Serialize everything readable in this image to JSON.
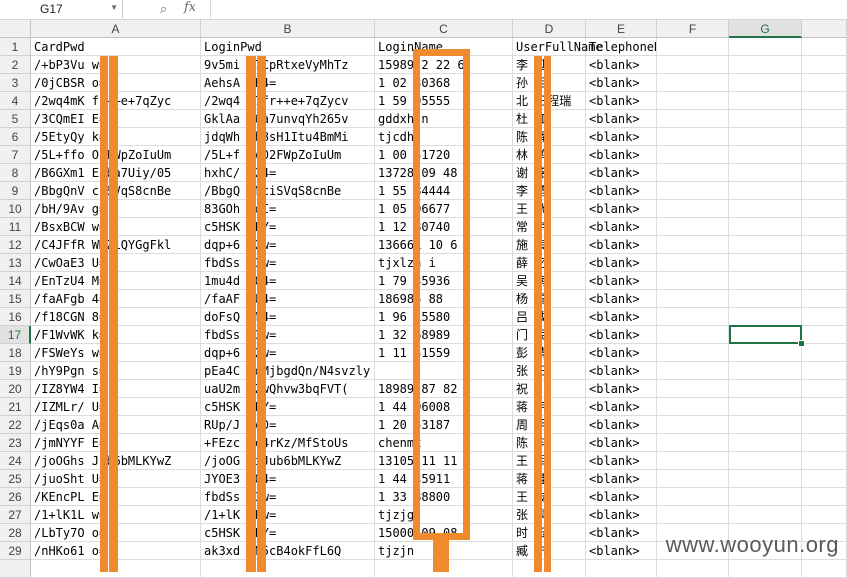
{
  "name_box": {
    "value": "G17"
  },
  "formula_bar": {
    "zoom_icon": "zoom-icon",
    "fx_label": "fx",
    "value": ""
  },
  "columns": [
    "A",
    "B",
    "C",
    "D",
    "E",
    "F",
    "G"
  ],
  "selected_cell": "G17",
  "header_row": [
    "CardPwd",
    "LoginPwd",
    "LoginName",
    "UserFullName",
    "TelephoneNumber",
    "",
    ""
  ],
  "rows": [
    [
      "/+bP3Vu  w=",
      "9v5mi  N7CpRtxeVyMhTz",
      "15989  2  22  6",
      "李  延",
      "<blank>"
    ],
    [
      "/0jCBSR  o=",
      "AehsA  zE4=",
      "1  02  30368",
      "孙  相",
      "<blank>"
    ],
    [
      "/2wq4mK  fr++e+7qZyc",
      "/2wq4  L7fr++e+7qZycv",
      "1  59  95555",
      "北  王程瑞",
      "<blank>"
    ],
    [
      "/3CQmEI  E=",
      "GklAa  S6a7unvqYh265v",
      "gddxh  n",
      "杜  江",
      "<blank>"
    ],
    [
      "/5EtyQy  k=",
      "jdqWh  gh8sH1Itu4BmMi",
      "tjcdh",
      "陈  辉",
      "<blank>"
    ],
    [
      "/5L+ffo  O2FWpZoIuUm",
      "/5L+f  6A02FWpZoIuUm",
      "1  00  51720",
      "林  鹏",
      "<blank>"
    ],
    [
      "/B6GXm1  E2ba7Uiy/05",
      "hxhC/  u24=",
      "13728  09  48",
      "谢  铭",
      "<blank>"
    ],
    [
      "/BbgQnV  ciSVqS8cnBe",
      "/BbgQ  tMciSVqS8cnBe",
      "1  55  84444",
      "李  勇",
      "<blank>"
    ],
    [
      "/bH/9Av  g=",
      "83GOh  FeI=",
      "1  05  06677",
      "王  飞",
      "<blank>"
    ],
    [
      "/BsxBCW  w=",
      "c5HSK  ILY=",
      "1  12  80740",
      "常  京",
      "<blank>"
    ],
    [
      "/C4JFfR  WMZ1QYGgFkl",
      "dqp+6  G2w=",
      "136661  10  6",
      "施  良",
      "<blank>"
    ],
    [
      "/CwOaE3  U=",
      "fbdSs  h3w=",
      "tjxlzh  i",
      "薛  忆",
      "<blank>"
    ],
    [
      "/EnTzU4  M=",
      "1mu4d  W04=",
      "1  79  35936",
      "吴  南",
      "<blank>"
    ],
    [
      "/faAFgb  4=",
      "/faAF  HU4=",
      "186985  88",
      "杨  国",
      "<blank>"
    ],
    [
      "/f18CGN  8=",
      "doFsQ  fM4=",
      "1  96  15580",
      "吕  成",
      "<blank>"
    ],
    [
      "/F1WvWK  k=",
      "fbdSs  h3w=",
      "1  32  68989",
      "门  民",
      "<blank>"
    ],
    [
      "/FSWeYs  w=",
      "dqp+6  G2w=",
      "1  11  51559",
      "彭  清",
      "<blank>"
    ],
    [
      "/hY9Pgn  s=",
      "pEa4C  beMjbgdQn/N4svzly",
      "",
      "张  日",
      "<blank>"
    ],
    [
      "/IZ8YW4  I=",
      "uaU2m  6ZwQhvw3bqFVT(",
      "18989  87  82",
      "祝  川",
      "<blank>"
    ],
    [
      "/IZMLr/  U=",
      "c5HSK  ILY=",
      "1  44  96008",
      "蒋  宇",
      "<blank>"
    ],
    [
      "/jEqs0a  A=",
      "RUp/J  oA0=",
      "1  20  53187",
      "周  明",
      "<blank>"
    ],
    [
      "/jmNYYF  E=",
      "+FEzc  dc4rKz/MfStoUs",
      "chenmx",
      "陈  科",
      "<blank>"
    ],
    [
      "/joOGhs  Jub6bMLKYwZ",
      "/joOG  miJub6bMLKYwZ",
      "13105  11  11",
      "王  军",
      "<blank>"
    ],
    [
      "/juoSht  U=",
      "JYOE3  YQ4=",
      "1  44  35911",
      "蒋  桂",
      "<blank>"
    ],
    [
      "/KEncPL  E=",
      "fbdSs  h3w=",
      "1  33  88800",
      "王  友",
      "<blank>"
    ],
    [
      "/1+lK1L  w=",
      "/1+lK  APw=",
      "tjzjg",
      "张  果",
      "<blank>"
    ],
    [
      "/LbTy7O  o=",
      "c5HSK  ILY=",
      "15000  09  08",
      "时  云",
      "<blank>"
    ],
    [
      "/nHKo61  o=",
      "ak3xd  8N5cB4okFfL6Q",
      "tjzjn",
      "臧  宁",
      "<blank>"
    ],
    [
      "",
      "",
      "",
      "",
      ""
    ]
  ],
  "watermark": "www.wooyun.org",
  "colors": {
    "redaction": "#f08a2e",
    "selection": "#217346",
    "header_bg": "#f0f0f0"
  }
}
